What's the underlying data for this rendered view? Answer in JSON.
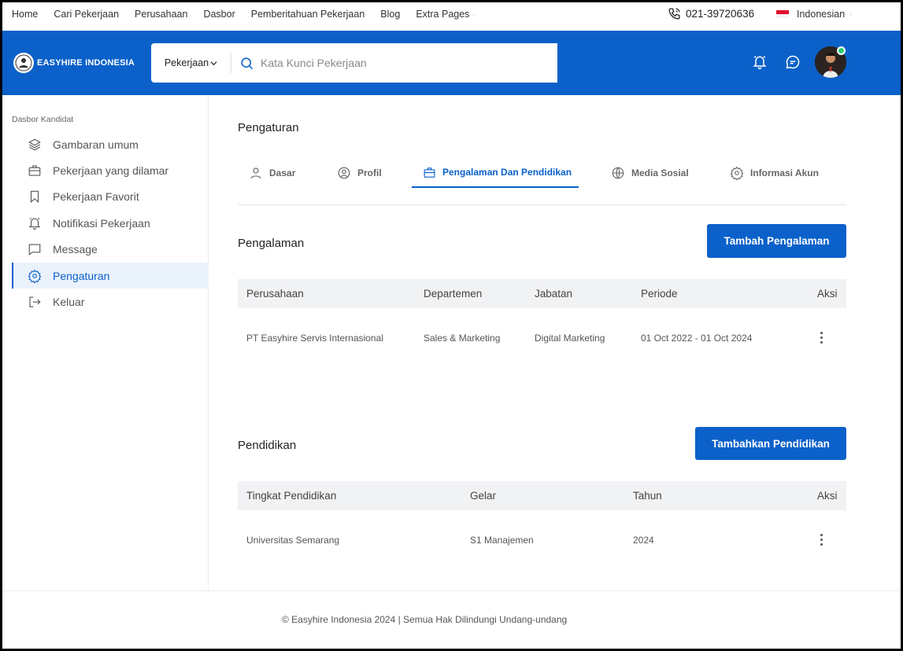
{
  "topnav": {
    "items": [
      "Home",
      "Cari Pekerjaan",
      "Perusahaan",
      "Dasbor",
      "Pemberitahuan Pekerjaan",
      "Blog",
      "Extra Pages"
    ],
    "phone": "021-39720636",
    "language": "Indonesian"
  },
  "header": {
    "logo_text": "EASYHIRE INDONESIA",
    "search_category": "Pekerjaan",
    "search_placeholder": "Kata Kunci Pekerjaan"
  },
  "sidebar": {
    "title": "Dasbor Kandidat",
    "items": [
      {
        "label": "Gambaran umum",
        "icon": "layers-icon"
      },
      {
        "label": "Pekerjaan yang dilamar",
        "icon": "briefcase-icon"
      },
      {
        "label": "Pekerjaan Favorit",
        "icon": "bookmark-icon"
      },
      {
        "label": "Notifikasi Pekerjaan",
        "icon": "bell-icon"
      },
      {
        "label": "Message",
        "icon": "message-icon"
      },
      {
        "label": "Pengaturan",
        "icon": "settings-icon",
        "active": true
      },
      {
        "label": "Keluar",
        "icon": "logout-icon"
      }
    ]
  },
  "main": {
    "title": "Pengaturan",
    "tabs": [
      {
        "label": "Dasar",
        "icon": "user-icon"
      },
      {
        "label": "Profil",
        "icon": "user-circle-icon"
      },
      {
        "label": "Pengalaman Dan Pendidikan",
        "icon": "briefcase-icon",
        "active": true
      },
      {
        "label": "Media Sosial",
        "icon": "globe-icon"
      },
      {
        "label": "Informasi Akun",
        "icon": "settings-icon"
      }
    ],
    "experience": {
      "title": "Pengalaman",
      "button": "Tambah Pengalaman",
      "headers": [
        "Perusahaan",
        "Departemen",
        "Jabatan",
        "Periode",
        "Aksi"
      ],
      "rows": [
        {
          "company": "PT Easyhire Servis Internasional",
          "department": "Sales & Marketing",
          "position": "Digital Marketing",
          "period": "01 Oct 2022 - 01 Oct 2024"
        }
      ]
    },
    "education": {
      "title": "Pendidikan",
      "button": "Tambahkan Pendidikan",
      "headers": [
        "Tingkat Pendidikan",
        "Gelar",
        "Tahun",
        "Aksi"
      ],
      "rows": [
        {
          "school": "Universitas Semarang",
          "degree": "S1 Manajemen",
          "year": "2024"
        }
      ]
    }
  },
  "footer": {
    "text": "© Easyhire Indonesia 2024 | Semua Hak Dilindungi Undang-undang"
  },
  "colors": {
    "primary": "#0b61c9",
    "online": "#2ecc71"
  }
}
